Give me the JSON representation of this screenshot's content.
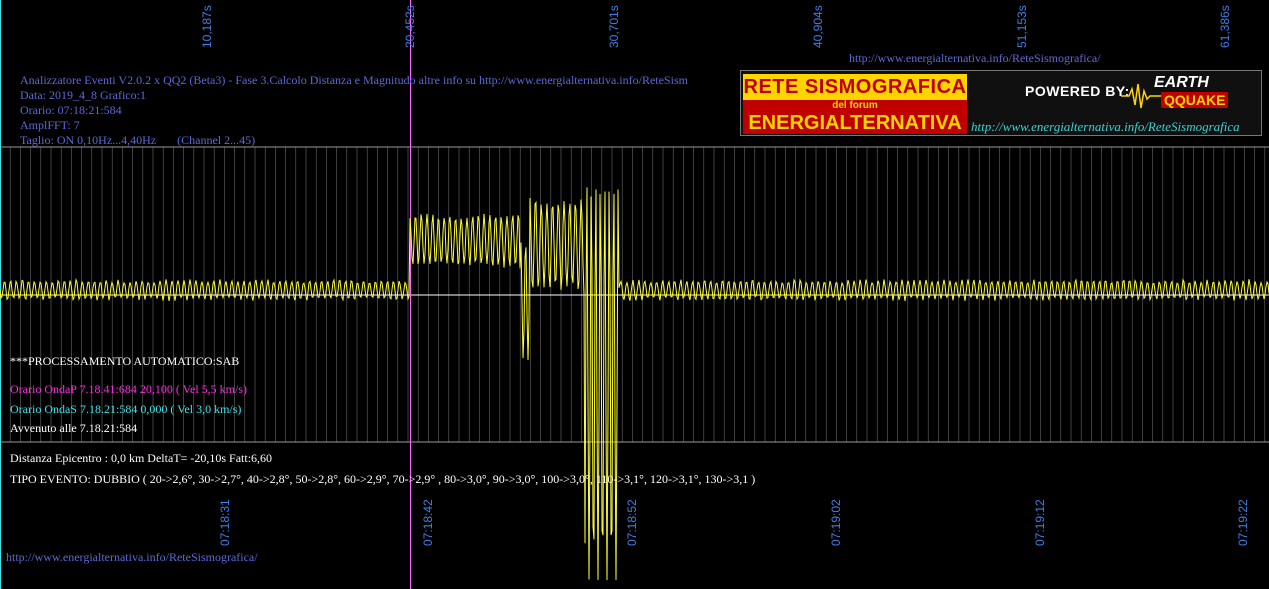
{
  "header": {
    "top_url": "http://www.energialternativa.info/ReteSismografica/",
    "info_lines": [
      "Analizzatore Eventi V2.0.2 x QQ2 (Beta3) - Fase 3.Calcolo Distanza e Magnitudo altre info su http://www.energialternativa.info/ReteSism",
      "Data: 2019_4_8 Grafico:1",
      "Orario: 07:18:21:584",
      "AmplFFT: 7",
      "Taglio: ON 0,10Hz...4,40Hz       (Channel 2...45)"
    ]
  },
  "logo": {
    "title_top": "RETE SISMOGRAFICA",
    "title_sub": "del forum",
    "title_bottom": "ENERGIALTERNATIVA",
    "powered_by": "POWERED BY:",
    "earth": "EARTH",
    "qquake": "QQUAKE",
    "url": "http://www.energialternativa.info/ReteSismografica"
  },
  "top_ticks": [
    "10,187s",
    "20,452s",
    "30,701s",
    "40,904s",
    "51,153s",
    "61,386s"
  ],
  "bottom_ticks": [
    "07:18:31",
    "07:18:42",
    "07:18:52",
    "07:19:02",
    "07:19:12",
    "07:19:22"
  ],
  "processing": {
    "title": "***PROCESSAMENTO AUTOMATICO:SAB",
    "onda_p": "Orario OndaP 7.18.41:684  20,100 ( Vel 5,5 km/s)",
    "onda_s": "Orario OndaS 7.18.21:584  0,000 ( Vel 3,0 km/s)",
    "avvenuto": "Avvenuto alle 7.18.21:584"
  },
  "results": {
    "distanza": "Distanza Epicentro : 0,0 km DeltaT= -20,10s  Fatt:6,60",
    "tipo_evento": "TIPO EVENTO: DUBBIO ( 20->2,6°, 30->2,7°, 40->2,8°, 50->2,8°, 60->2,9°, 70->2,9° , 80->3,0°, 90->3,0°, 100->3,0°, 110->3,1°, 120->3,1°, 130->3,1 )"
  },
  "footer_url": "http://www.energialternativa.info/ReteSismografica/",
  "colors": {
    "background": "#000000",
    "trace": "#ffff33",
    "p_marker": "#ff66ff",
    "s_marker": "#39e6ea",
    "grid": "#8a8a8a",
    "axis_label": "#3f7fe6"
  }
}
